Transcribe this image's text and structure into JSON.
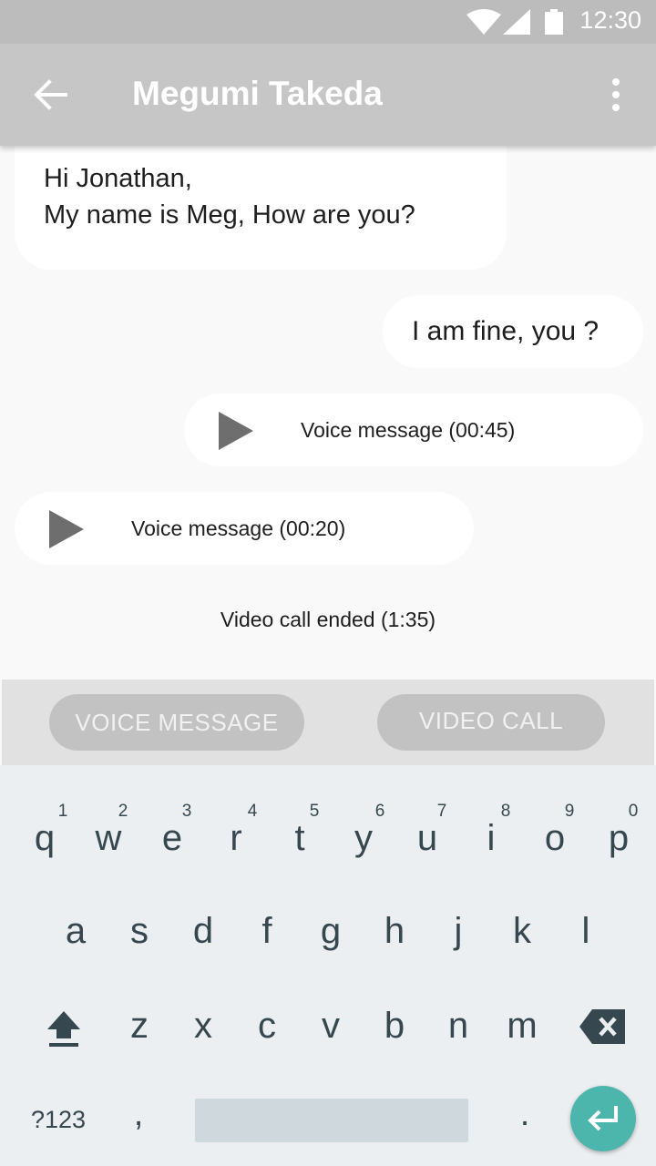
{
  "status_bar": {
    "time": "12:30"
  },
  "app_bar": {
    "title": "Megumi Takeda"
  },
  "messages": [
    {
      "type": "incoming",
      "lines": [
        "Hi Jonathan,",
        "My name is Meg, How are you?"
      ]
    },
    {
      "type": "outgoing",
      "text": "I am fine, you ?"
    },
    {
      "type": "outgoing_voice",
      "label": "Voice message (00:45)"
    },
    {
      "type": "incoming_voice",
      "label": "Voice message (00:20)"
    },
    {
      "type": "system",
      "text": "Video call ended (1:35)"
    }
  ],
  "actions": {
    "voice_message": "VOICE MESSAGE",
    "video_call": "VIDEO CALL"
  },
  "keyboard": {
    "row1": [
      "q",
      "w",
      "e",
      "r",
      "t",
      "y",
      "u",
      "i",
      "o",
      "p"
    ],
    "row1_hints": [
      "1",
      "2",
      "3",
      "4",
      "5",
      "6",
      "7",
      "8",
      "9",
      "0"
    ],
    "row2": [
      "a",
      "s",
      "d",
      "f",
      "g",
      "h",
      "j",
      "k",
      "l"
    ],
    "row3": [
      "z",
      "x",
      "c",
      "v",
      "b",
      "n",
      "m"
    ],
    "symbols": "?123",
    "comma": ",",
    "period": "."
  },
  "colors": {
    "status_bar": "#bcbcbc",
    "app_bar": "#c6c6c6",
    "chat_background": "#f9f9f9",
    "bubble": "#ffffff",
    "action_button": "#c2c2c2",
    "keyboard": "#eceff1",
    "enter_key": "#4db6ac"
  }
}
